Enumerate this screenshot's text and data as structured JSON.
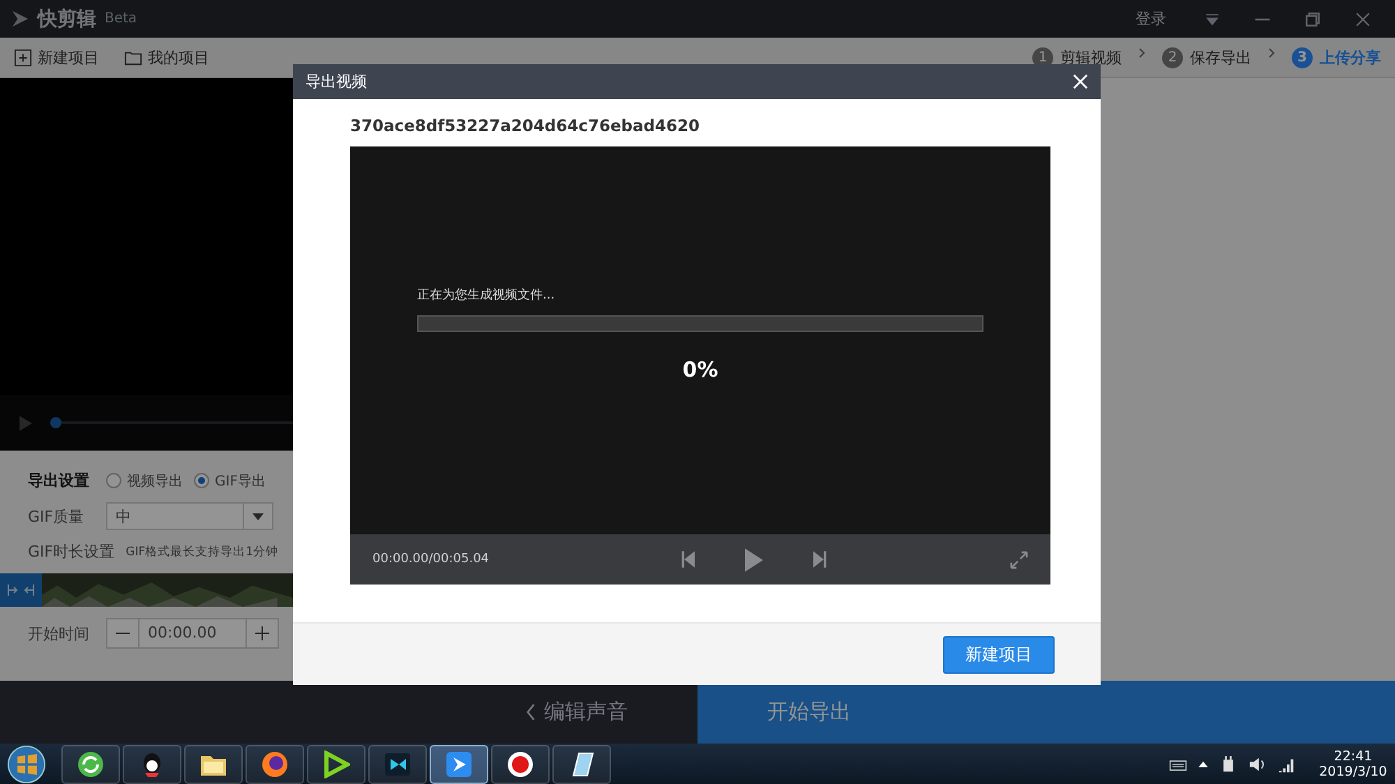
{
  "app": {
    "title": "快剪辑",
    "badge": "Beta",
    "login": "登录"
  },
  "toolbar": {
    "actions": [
      {
        "kind": "new",
        "label": "新建项目"
      },
      {
        "kind": "folder",
        "label": "我的项目"
      }
    ]
  },
  "steps": [
    {
      "number": "1",
      "label": "剪辑视频",
      "selected": false
    },
    {
      "number": "2",
      "label": "保存导出",
      "selected": false
    },
    {
      "number": "3",
      "label": "上传分享",
      "selected": true
    }
  ],
  "preview": {
    "scrubber": {
      "level": 0.02
    }
  },
  "export_settings": {
    "label": "导出设置",
    "options": [
      {
        "label": "视频导出",
        "selected": false
      },
      {
        "label": "GIF导出",
        "selected": true
      }
    ],
    "quality_label": "GIF质量",
    "quality_value": "中",
    "duration_label": "GIF时长设置",
    "duration_hint": "GIF格式最长支持导出1分钟",
    "start_time_label": "开始时间",
    "start_time_value": "00:00.00"
  },
  "bottom_bar": {
    "back": "编辑声音",
    "export": "开始导出"
  },
  "dialog": {
    "title": "导出视频",
    "file_name": "370ace8df53227a204d64c76ebad4620",
    "progress_text": "正在为您生成视频文件...",
    "progress": {
      "level": 0
    },
    "percent": "0%",
    "time": "00:00.00/00:05.04",
    "button": "新建项目"
  },
  "taskbar": {
    "apps": [
      {
        "kind": "browser",
        "selected": false
      },
      {
        "kind": "penguin",
        "selected": false
      },
      {
        "kind": "folder",
        "selected": false
      },
      {
        "kind": "firefox",
        "selected": false
      },
      {
        "kind": "green",
        "selected": false
      },
      {
        "kind": "video",
        "selected": false
      },
      {
        "kind": "play",
        "selected": true
      },
      {
        "kind": "record",
        "selected": false
      },
      {
        "kind": "notepad",
        "selected": false
      }
    ],
    "clock": {
      "time": "22:41",
      "date": "2019/3/10"
    }
  }
}
